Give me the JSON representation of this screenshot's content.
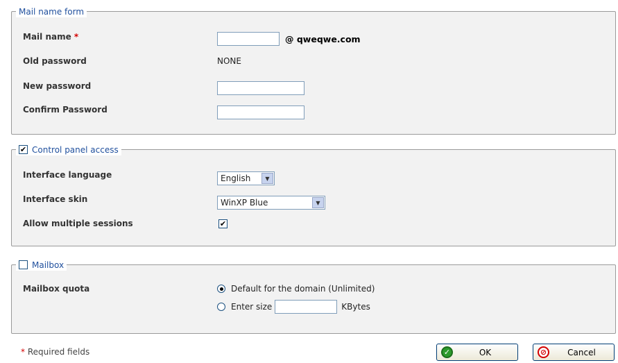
{
  "mail_form": {
    "legend": "Mail name form",
    "mail_name_label": "Mail name",
    "required_mark": "*",
    "mail_name_value": "",
    "domain_suffix": "@ qweqwe.com",
    "old_password_label": "Old password",
    "old_password_value": "NONE",
    "new_password_label": "New password",
    "new_password_value": "",
    "confirm_password_label": "Confirm Password",
    "confirm_password_value": ""
  },
  "cp_access": {
    "legend": "Control panel access",
    "enabled": true,
    "language_label": "Interface language",
    "language_value": "English",
    "skin_label": "Interface skin",
    "skin_value": "WinXP Blue",
    "multi_sessions_label": "Allow multiple sessions",
    "multi_sessions_checked": true
  },
  "mailbox": {
    "legend": "Mailbox",
    "enabled": false,
    "quota_label": "Mailbox quota",
    "option_default": "Default for the domain (Unlimited)",
    "option_enter_size": "Enter size",
    "size_value": "",
    "size_unit": "KBytes",
    "selected": "default"
  },
  "footer": {
    "required_mark": "*",
    "required_note": "Required fields",
    "ok_label": "OK",
    "cancel_label": "Cancel"
  }
}
